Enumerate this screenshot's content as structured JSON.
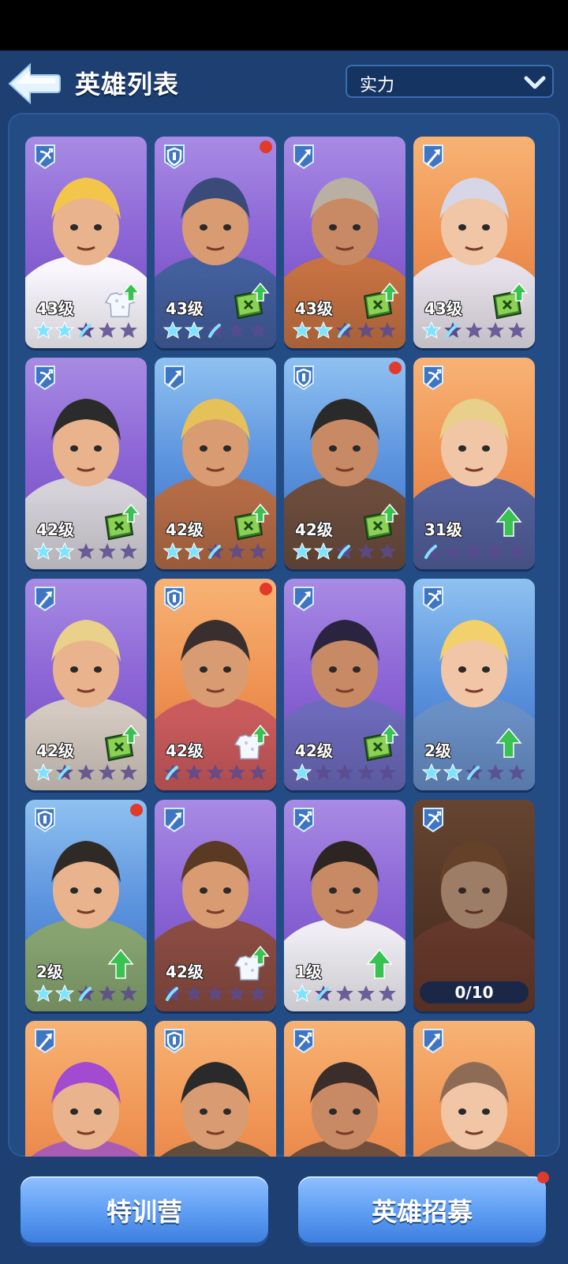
{
  "header": {
    "title": "英雄列表",
    "sort_value": "实力"
  },
  "heroes": [
    {
      "level": "43级",
      "rarity": "purple",
      "class": "crossbow",
      "stars": [
        1,
        1,
        0.5,
        0,
        0
      ],
      "upgrade": "outfit",
      "dot": false
    },
    {
      "level": "43级",
      "rarity": "purple",
      "class": "shield",
      "stars": [
        1,
        1,
        0.5,
        0,
        0
      ],
      "upgrade": "book",
      "dot": true
    },
    {
      "level": "43级",
      "rarity": "purple",
      "class": "spear",
      "stars": [
        1,
        1,
        0.5,
        0,
        0
      ],
      "upgrade": "book",
      "dot": false
    },
    {
      "level": "43级",
      "rarity": "orange",
      "class": "spear",
      "stars": [
        1,
        0.5,
        0,
        0,
        0
      ],
      "upgrade": "book",
      "dot": false
    },
    {
      "level": "42级",
      "rarity": "purple",
      "class": "crossbow",
      "stars": [
        1,
        1,
        0,
        0,
        0
      ],
      "upgrade": "book",
      "dot": false
    },
    {
      "level": "42级",
      "rarity": "blue",
      "class": "spear",
      "stars": [
        1,
        1,
        0.5,
        0,
        0
      ],
      "upgrade": "book",
      "dot": false
    },
    {
      "level": "42级",
      "rarity": "blue",
      "class": "shield",
      "stars": [
        1,
        1,
        0.5,
        0,
        0
      ],
      "upgrade": "book",
      "dot": true
    },
    {
      "level": "31级",
      "rarity": "orange",
      "class": "crossbow",
      "stars": [
        0.5,
        0,
        0,
        0,
        0
      ],
      "upgrade": "arrow",
      "dot": false
    },
    {
      "level": "42级",
      "rarity": "purple",
      "class": "spear",
      "stars": [
        1,
        0.5,
        0,
        0,
        0
      ],
      "upgrade": "book",
      "dot": false
    },
    {
      "level": "42级",
      "rarity": "orange",
      "class": "shield",
      "stars": [
        0.5,
        0,
        0,
        0,
        0
      ],
      "upgrade": "outfit",
      "dot": true
    },
    {
      "level": "42级",
      "rarity": "purple",
      "class": "spear",
      "stars": [
        1,
        0,
        0,
        0,
        0
      ],
      "upgrade": "book",
      "dot": false
    },
    {
      "level": "2级",
      "rarity": "blue",
      "class": "crossbow",
      "stars": [
        1,
        1,
        0.5,
        0,
        0
      ],
      "upgrade": "arrow",
      "dot": false
    },
    {
      "level": "2级",
      "rarity": "blue",
      "class": "shield",
      "stars": [
        1,
        1,
        0.5,
        0,
        0
      ],
      "upgrade": "arrow",
      "dot": true
    },
    {
      "level": "42级",
      "rarity": "purple",
      "class": "spear",
      "stars": [
        0.5,
        0,
        0,
        0,
        0
      ],
      "upgrade": "outfit",
      "dot": false
    },
    {
      "level": "1级",
      "rarity": "purple",
      "class": "crossbow",
      "stars": [
        1,
        0.5,
        0,
        0,
        0
      ],
      "upgrade": "arrow",
      "dot": false
    },
    {
      "level": "",
      "rarity": "locked",
      "class": "crossbow",
      "stars": [],
      "upgrade": "none",
      "dot": false,
      "progress": "0/10"
    },
    {
      "level": "",
      "rarity": "orange",
      "class": "spear",
      "stars": [],
      "upgrade": "none",
      "dot": false
    },
    {
      "level": "",
      "rarity": "orange",
      "class": "shield",
      "stars": [],
      "upgrade": "none",
      "dot": false
    },
    {
      "level": "",
      "rarity": "orange",
      "class": "crossbow",
      "stars": [],
      "upgrade": "none",
      "dot": false
    },
    {
      "level": "",
      "rarity": "orange",
      "class": "spear",
      "stars": [],
      "upgrade": "none",
      "dot": false
    }
  ],
  "buttons": {
    "training_camp": "特训营",
    "recruit": "英雄招募"
  },
  "colors": {
    "background": "#1d3f72",
    "star_filled": "#7fe3ff",
    "star_empty": "#5b4a8e",
    "notify": "#e23a2a",
    "upgrade_green": "#39c152"
  }
}
